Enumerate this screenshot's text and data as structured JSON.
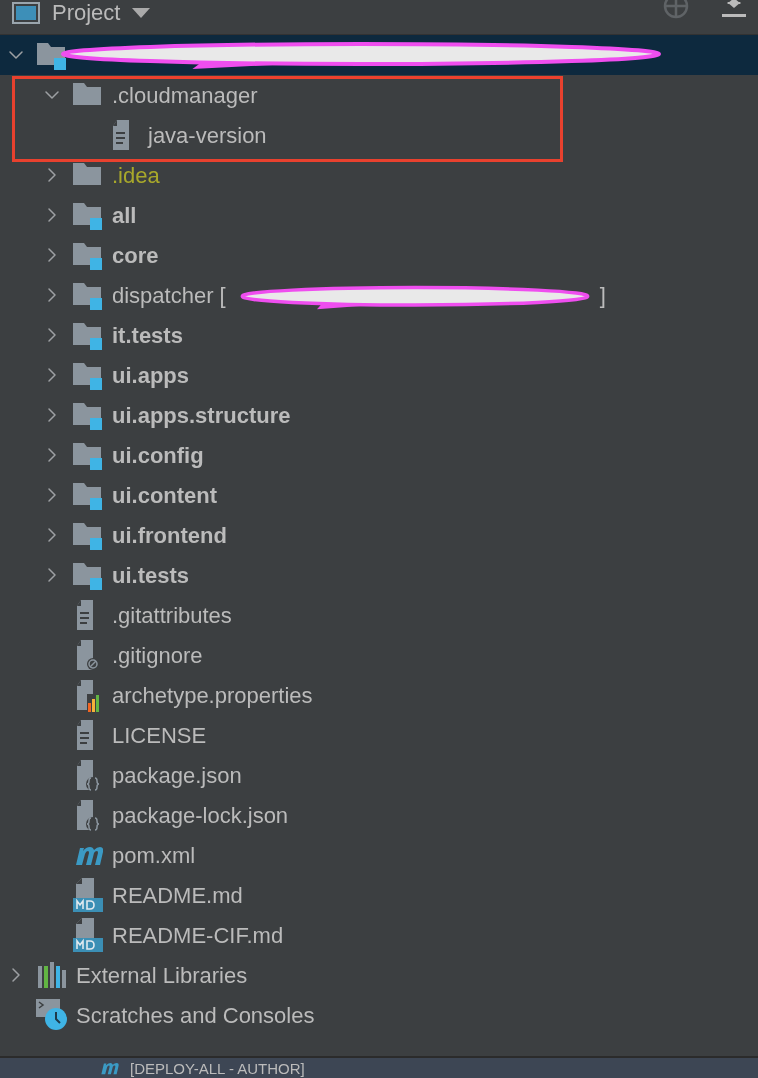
{
  "panel": {
    "title": "Project"
  },
  "tree": [
    {
      "kind": "module",
      "selected": true,
      "redacted": true,
      "expanded": true,
      "children": [
        {
          "label": ".cloudmanager",
          "kind": "folder",
          "bold": false,
          "ignored": false,
          "selected": false,
          "highlighted": true,
          "expanded": true,
          "children": [
            {
              "label": "java-version",
              "kind": "text",
              "bold": false,
              "ignored": false,
              "selected": false
            }
          ]
        },
        {
          "label": ".idea",
          "kind": "folder",
          "bold": false,
          "ignored": true,
          "selected": false,
          "expanded": false
        },
        {
          "label": "all",
          "kind": "module",
          "bold": true,
          "ignored": false,
          "selected": false,
          "expanded": false
        },
        {
          "label": "core",
          "kind": "module",
          "bold": true,
          "ignored": false,
          "selected": false,
          "expanded": false
        },
        {
          "label": "dispatcher [",
          "kind": "module",
          "bold": false,
          "ignored": false,
          "selected": false,
          "redacted": true,
          "tail": "]",
          "expanded": false
        },
        {
          "label": "it.tests",
          "kind": "module",
          "bold": true,
          "ignored": false,
          "selected": false,
          "expanded": false
        },
        {
          "label": "ui.apps",
          "kind": "module",
          "bold": true,
          "ignored": false,
          "selected": false,
          "expanded": false
        },
        {
          "label": "ui.apps.structure",
          "kind": "module",
          "bold": true,
          "ignored": false,
          "selected": false,
          "expanded": false
        },
        {
          "label": "ui.config",
          "kind": "module",
          "bold": true,
          "ignored": false,
          "selected": false,
          "expanded": false
        },
        {
          "label": "ui.content",
          "kind": "module",
          "bold": true,
          "ignored": false,
          "selected": false,
          "expanded": false
        },
        {
          "label": "ui.frontend",
          "kind": "module",
          "bold": true,
          "ignored": false,
          "selected": false,
          "expanded": false
        },
        {
          "label": "ui.tests",
          "kind": "module",
          "bold": true,
          "ignored": false,
          "selected": false,
          "expanded": false
        },
        {
          "label": ".gitattributes",
          "kind": "text",
          "bold": false,
          "ignored": false,
          "selected": false
        },
        {
          "label": ".gitignore",
          "kind": "gitignore",
          "bold": false,
          "ignored": false,
          "selected": false
        },
        {
          "label": "archetype.properties",
          "kind": "properties",
          "bold": false,
          "ignored": false,
          "selected": false
        },
        {
          "label": "LICENSE",
          "kind": "text",
          "bold": false,
          "ignored": false,
          "selected": false
        },
        {
          "label": "package.json",
          "kind": "json",
          "bold": false,
          "ignored": false,
          "selected": false
        },
        {
          "label": "package-lock.json",
          "kind": "json",
          "bold": false,
          "ignored": false,
          "selected": false
        },
        {
          "label": "pom.xml",
          "kind": "maven",
          "bold": false,
          "ignored": false,
          "selected": false
        },
        {
          "label": "README.md",
          "kind": "markdown",
          "bold": false,
          "ignored": false,
          "selected": false
        },
        {
          "label": "README-CIF.md",
          "kind": "markdown",
          "bold": false,
          "ignored": false,
          "selected": false
        }
      ]
    },
    {
      "label": "External Libraries",
      "kind": "libraries",
      "selected": false,
      "expanded": false
    },
    {
      "label": "Scratches and Consoles",
      "kind": "scratches",
      "selected": false
    }
  ],
  "run_bar": {
    "label": "[DEPLOY-ALL - AUTHOR]"
  }
}
